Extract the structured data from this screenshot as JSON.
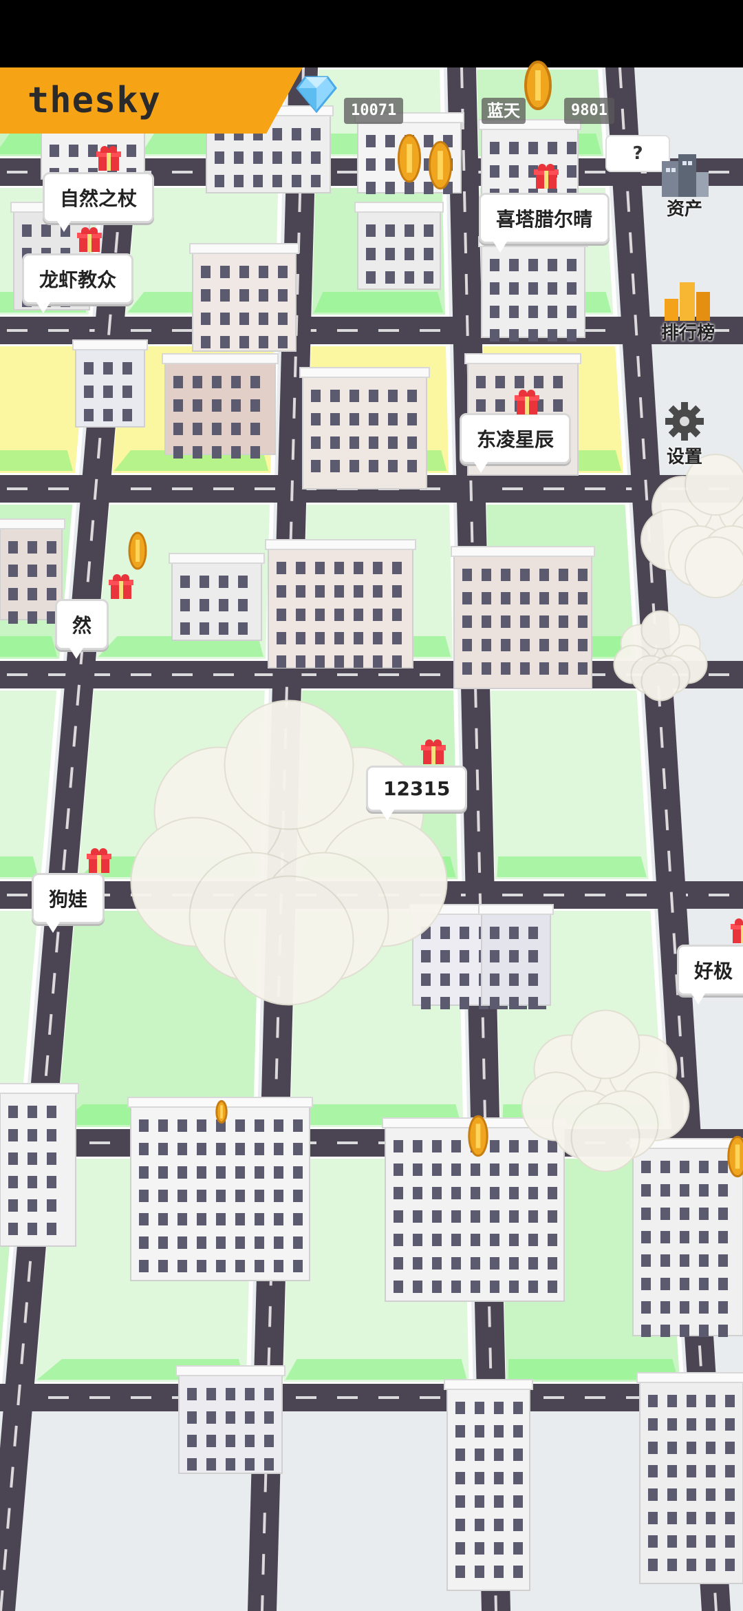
{
  "player": {
    "name": "thesky"
  },
  "currencies": [
    {
      "icon": "diamond-icon",
      "value": "10071"
    },
    {
      "icon": "gold-coin-icon",
      "value": "9801"
    }
  ],
  "partial_header_text": "蓝天",
  "menu": {
    "help": "?",
    "assets": "资产",
    "leaderboard": "排行榜",
    "settings": "设置"
  },
  "players_on_map": [
    {
      "name": "自然之杖"
    },
    {
      "name": "龙虾教众"
    },
    {
      "name": "喜塔腊尔晴"
    },
    {
      "name": "东凌星辰"
    },
    {
      "name": "然"
    },
    {
      "name": "12315"
    },
    {
      "name": "狗娃"
    },
    {
      "name": "好极"
    }
  ],
  "colors": {
    "name_bar": "#f7a316",
    "road": "#4b4553",
    "grass_glow": "#7df27a",
    "lot_yellow": "#fbf6a0"
  }
}
